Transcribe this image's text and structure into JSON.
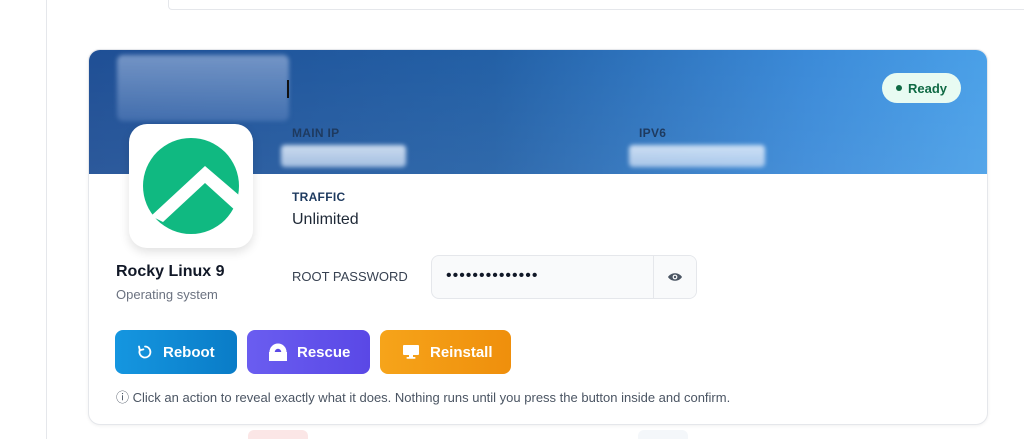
{
  "server": {
    "status": "Ready"
  },
  "fields": {
    "main_ip_label": "MAIN IP",
    "ipv6_label": "IPV6",
    "traffic_label": "TRAFFIC",
    "traffic_value": "Unlimited",
    "root_password_label": "ROOT PASSWORD",
    "root_password_value": "••••••••••••••"
  },
  "os": {
    "name": "Rocky Linux 9",
    "subtitle": "Operating system"
  },
  "actions": {
    "reboot_label": "Reboot",
    "rescue_label": "Rescue",
    "reinstall_label": "Reinstall"
  },
  "hint": "ⓘ Click an action to reveal exactly what it does. Nothing runs until you press the button inside and confirm.",
  "colors": {
    "hero_dark": "#1f4f95",
    "hero_light": "#4aa0e8",
    "status_bg": "#e8fbf2",
    "status_text": "#0f6a44",
    "reboot": "#0a7cc7",
    "rescue": "#5a48e6",
    "reinstall": "#ef8f0c",
    "rocky_green": "#10b981"
  },
  "icons": {
    "reboot": "restart-icon",
    "rescue": "lifebuoy-icon",
    "reinstall": "monitor-icon",
    "reveal": "eye-icon",
    "os_logo": "rocky-linux-logo"
  }
}
